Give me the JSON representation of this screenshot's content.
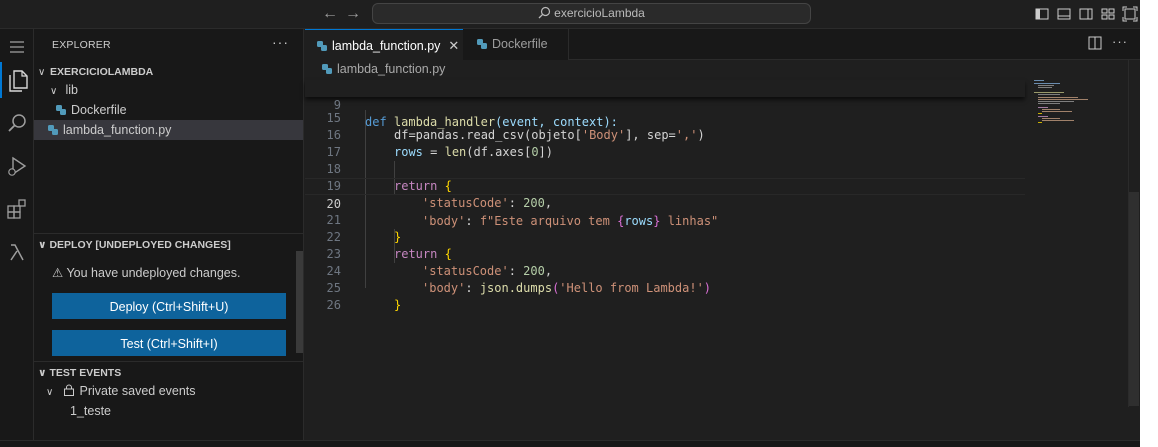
{
  "titlebar": {
    "search_text": "exercicioLambda"
  },
  "sidebar": {
    "title": "EXPLORER",
    "more": "···",
    "folder": "EXERCICIOLAMBDA",
    "tree": [
      {
        "label": "lib"
      },
      {
        "label": "Dockerfile"
      },
      {
        "label": "lambda_function.py"
      }
    ],
    "deploy": {
      "header": "DEPLOY [UNDEPLOYED CHANGES]",
      "warning": "You have undeployed changes.",
      "deploy_button": "Deploy (Ctrl+Shift+U)",
      "test_button": "Test (Ctrl+Shift+I)"
    },
    "test_events": {
      "header": "TEST EVENTS",
      "group": "Private saved events",
      "item": "1_teste"
    }
  },
  "editor": {
    "tabs": [
      {
        "label": "lambda_function.py",
        "active": true
      },
      {
        "label": "Dockerfile",
        "active": false
      }
    ],
    "breadcrumb": "lambda_function.py",
    "sticky": {
      "num": "9",
      "kw": "def",
      "fn": "lambda_handler",
      "params": "(event, context):"
    },
    "lines": {
      "l15": {
        "num": "15",
        "a": "df=pandas.read_csv(objeto[",
        "b": "'Body'",
        "c": "], sep=",
        "d": "','",
        "e": ")"
      },
      "l16": {
        "num": "16",
        "a": "rows",
        "b": " = ",
        "c": "len",
        "d": "(df.axes[",
        "e": "0",
        "f": "])"
      },
      "l17": {
        "num": "17"
      },
      "l18": {
        "num": "18",
        "a": "return",
        "b": " {"
      },
      "l19": {
        "num": "19",
        "a": "'statusCode'",
        "b": ": ",
        "c": "200",
        "d": ","
      },
      "l20": {
        "num": "20",
        "a": "'body'",
        "b": ": ",
        "c": "f\"Este arquivo tem ",
        "d": "{",
        "e": "rows",
        "f": "}",
        "g": " linhas\""
      },
      "l21": {
        "num": "21",
        "a": "}"
      },
      "l22": {
        "num": "22",
        "a": "return",
        "b": " {"
      },
      "l23": {
        "num": "23",
        "a": "'statusCode'",
        "b": ": ",
        "c": "200",
        "d": ","
      },
      "l24": {
        "num": "24",
        "a": "'body'",
        "b": ": ",
        "c": "json.dumps",
        "d": "(",
        "e": "'Hello from Lambda!'",
        "f": ")"
      },
      "l25": {
        "num": "25",
        "a": "}"
      },
      "l26": {
        "num": "26"
      }
    }
  },
  "colors": {
    "accent": "#0078d4",
    "button": "#0e639c",
    "python_icon": "#519aba"
  }
}
